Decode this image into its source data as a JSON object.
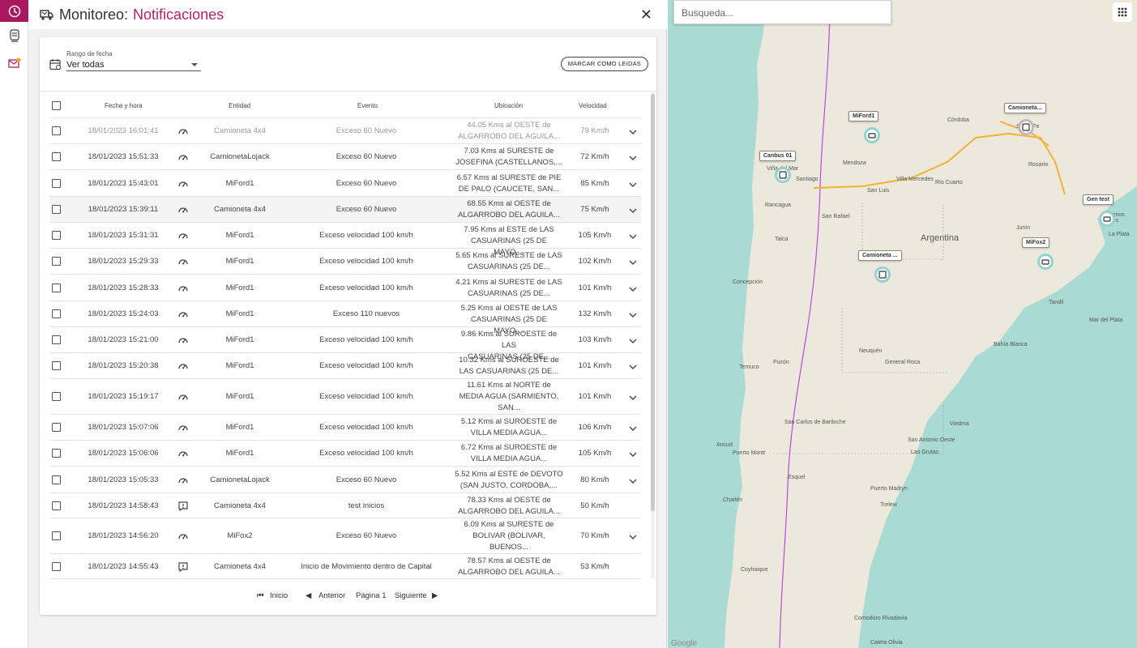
{
  "header": {
    "title_prefix": "Monitoreo:",
    "title_section": "Notificaciones",
    "close_icon": "close-icon"
  },
  "filter": {
    "label": "Rango de fecha",
    "value": "Ver todas"
  },
  "mark_read_label": "MARCAR COMO LEIDAS",
  "columns": {
    "date": "Fecha y hora",
    "entity": "Entidad",
    "event": "Evento",
    "location": "Ubicación",
    "speed": "Velocidad"
  },
  "rows": [
    {
      "date": "18/01/2023 16:01:41",
      "icon": "speedometer-icon",
      "entity": "Camioneta 4x4",
      "event": "Exceso 60 Nuevo",
      "loc1": "44.05 Kms al OESTE de",
      "loc2": "ALGARROBO DEL AGUILA...",
      "loc3": "",
      "speed": "79 Km/h",
      "expand": true
    },
    {
      "date": "18/01/2023 15:51:33",
      "icon": "speedometer-icon",
      "entity": "CamionetaLojack",
      "event": "Exceso 60 Nuevo",
      "loc1": "7.03 Kms al SURESTE de",
      "loc2": "JOSEFINA (CASTELLANOS,...",
      "loc3": "",
      "speed": "72 Km/h",
      "expand": true
    },
    {
      "date": "18/01/2023 15:43:01",
      "icon": "speedometer-icon",
      "entity": "MiFord1",
      "event": "Exceso 60 Nuevo",
      "loc1": "6.57 Kms al SURESTE de PIE",
      "loc2": "DE PALO (CAUCETE, SAN...",
      "loc3": "",
      "speed": "85 Km/h",
      "expand": true
    },
    {
      "date": "18/01/2023 15:39:11",
      "icon": "speedometer-icon",
      "entity": "Camioneta 4x4",
      "event": "Exceso 60 Nuevo",
      "loc1": "68.55 Kms al OESTE de",
      "loc2": "ALGARROBO DEL AGUILA...",
      "loc3": "",
      "speed": "75 Km/h",
      "expand": true
    },
    {
      "date": "18/01/2023 15:31:31",
      "icon": "speedometer-icon",
      "entity": "MiFord1",
      "event": "Exceso velocidad 100 km/h",
      "loc1": "7.95 Kms al ESTE de LAS",
      "loc2": "CASUARINAS (25 DE MAYO,...",
      "loc3": "",
      "speed": "105 Km/h",
      "expand": true
    },
    {
      "date": "18/01/2023 15:29:33",
      "icon": "speedometer-icon",
      "entity": "MiFord1",
      "event": "Exceso velocidad 100 km/h",
      "loc1": "5.65 Kms al SURESTE de LAS",
      "loc2": "CASUARINAS (25 DE...",
      "loc3": "",
      "speed": "102 Km/h",
      "expand": true
    },
    {
      "date": "18/01/2023 15:28:33",
      "icon": "speedometer-icon",
      "entity": "MiFord1",
      "event": "Exceso velocidad 100 km/h",
      "loc1": "4.21 Kms al SURESTE de LAS",
      "loc2": "CASUARINAS (25 DE...",
      "loc3": "",
      "speed": "101 Km/h",
      "expand": true
    },
    {
      "date": "18/01/2023 15:24:03",
      "icon": "speedometer-icon",
      "entity": "MiFord1",
      "event": "Exceso 110 nuevos",
      "loc1": "5.25 Kms al OESTE de LAS",
      "loc2": "CASUARINAS (25 DE MAYO,...",
      "loc3": "",
      "speed": "132 Km/h",
      "expand": true
    },
    {
      "date": "18/01/2023 15:21:00",
      "icon": "speedometer-icon",
      "entity": "MiFord1",
      "event": "Exceso velocidad 100 km/h",
      "loc1": "9.86 Kms al SUROESTE de LAS",
      "loc2": "CASUARINAS (25 DE...",
      "loc3": "",
      "speed": "103 Km/h",
      "expand": true
    },
    {
      "date": "18/01/2023 15:20:38",
      "icon": "speedometer-icon",
      "entity": "MiFord1",
      "event": "Exceso velocidad 100 km/h",
      "loc1": "10.32 Kms al SUROESTE de",
      "loc2": "LAS CASUARINAS (25 DE...",
      "loc3": "",
      "speed": "101 Km/h",
      "expand": true
    },
    {
      "date": "18/01/2023 15:19:17",
      "icon": "speedometer-icon",
      "entity": "MiFord1",
      "event": "Exceso velocidad 100 km/h",
      "loc1": "11.61 Kms al NORTE de",
      "loc2": "MEDIA AGUA (SARMIENTO,",
      "loc3": "SAN...",
      "speed": "101 Km/h",
      "expand": true
    },
    {
      "date": "18/01/2023 15:07:06",
      "icon": "speedometer-icon",
      "entity": "MiFord1",
      "event": "Exceso velocidad 100 km/h",
      "loc1": "5.12 Kms al SUROESTE de",
      "loc2": "VILLA MEDIA AGUA...",
      "loc3": "",
      "speed": "106 Km/h",
      "expand": true
    },
    {
      "date": "18/01/2023 15:06:06",
      "icon": "speedometer-icon",
      "entity": "MiFord1",
      "event": "Exceso velocidad 100 km/h",
      "loc1": "6.72 Kms al SUROESTE de",
      "loc2": "VILLA MEDIA AGUA...",
      "loc3": "",
      "speed": "105 Km/h",
      "expand": true
    },
    {
      "date": "18/01/2023 15:05:33",
      "icon": "speedometer-icon",
      "entity": "CamionetaLojack",
      "event": "Exceso 60 Nuevo",
      "loc1": "5.52 Kms al ESTE de DEVOTO",
      "loc2": "(SAN JUSTO, CORDOBA,...",
      "loc3": "",
      "speed": "80 Km/h",
      "expand": true
    },
    {
      "date": "18/01/2023 14:58:43",
      "icon": "alert-icon",
      "entity": "Camioneta 4x4",
      "event": "test inicios",
      "loc1": "78.33 Kms al OESTE de",
      "loc2": "ALGARROBO DEL AGUILA...",
      "loc3": "",
      "speed": "50 Km/h",
      "expand": false
    },
    {
      "date": "18/01/2023 14:56:20",
      "icon": "speedometer-icon",
      "entity": "MiFox2",
      "event": "Exceso 60 Nuevo",
      "loc1": "6.09 Kms al SURESTE de",
      "loc2": "BOLIVAR (BOLIVAR,",
      "loc3": "BUENOS...",
      "speed": "70 Km/h",
      "expand": true
    },
    {
      "date": "18/01/2023 14:55:43",
      "icon": "alert-icon",
      "entity": "Camioneta 4x4",
      "event": "Inicio de Movimiento dentro de Capital",
      "loc1": "78.57 Kms al OESTE de",
      "loc2": "ALGARROBO DEL AGUILA...",
      "loc3": "",
      "speed": "53 Km/h",
      "expand": false
    }
  ],
  "pager": {
    "first": "Inicio",
    "prev": "Anterior",
    "page": "Página 1",
    "next": "Siguiente"
  },
  "map": {
    "search_placeholder": "Busqueda...",
    "country": "Argentina",
    "cities": [
      "Córdoba",
      "Santa Fe",
      "Rosario",
      "Mendoza",
      "Santiago",
      "Viña del Mar",
      "San Rafael",
      "Talca",
      "Concepción",
      "Temuco",
      "Neuquén",
      "Bahía Blanca",
      "San Carlos de Bariloche",
      "Puerto Montt",
      "General Roca",
      "Buenos Aires",
      "La Plata",
      "Mar del Plata",
      "Rancagua",
      "Pucón",
      "Ancud",
      "Esquel",
      "Comodoro Rivadavia",
      "Chaitén",
      "Caleta Olivia",
      "Puerto Madryn",
      "Trelew",
      "Viedma",
      "San Antonio Oeste",
      "Coyhaique",
      "Las Grutas",
      "Villa Mercedes",
      "San Luis",
      "Río Cuarto",
      "Junín",
      "Tandil"
    ],
    "vehicles": [
      "MiFord1",
      "Camioneta...",
      "Canbus 01",
      "Gen test",
      "MiFox2",
      "Camioneta ..."
    ],
    "attribution": "Google",
    "colors": {
      "land": "#ece8dc",
      "water": "#aadad4",
      "route": "#f2b136",
      "border": "#b94bd8"
    }
  },
  "icons": {
    "rail": [
      "clock-icon",
      "vehicle-list-icon",
      "mail-notification-icon"
    ],
    "header": "truck-notification-icon",
    "filter": "calendar-icon",
    "apps": "apps-grid-icon"
  }
}
